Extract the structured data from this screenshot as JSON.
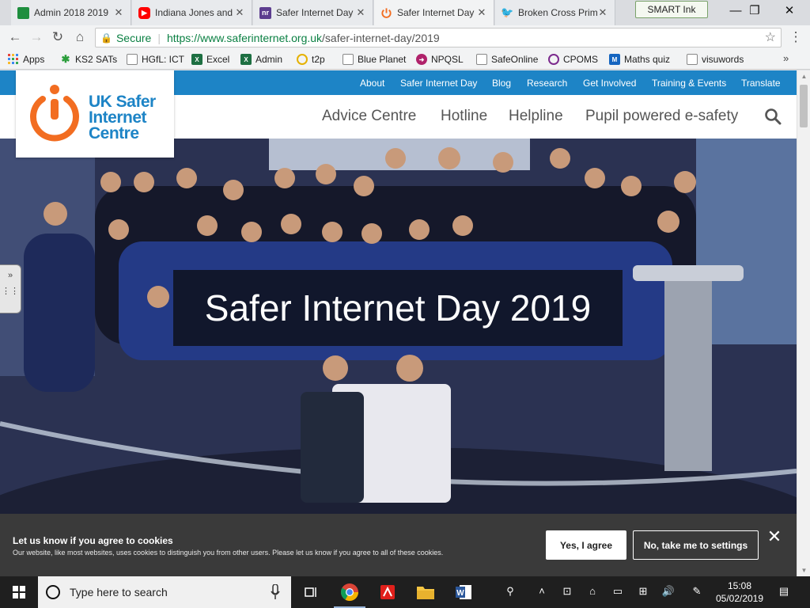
{
  "browser": {
    "tabs": [
      {
        "title": "Admin 2018 2019",
        "favicon": "google-sheets-icon",
        "color": "#1e8e3e"
      },
      {
        "title": "Indiana Jones and",
        "favicon": "youtube-icon",
        "color": "#ff0000"
      },
      {
        "title": "Safer Internet Day",
        "favicon": "nr-icon",
        "color": "#5c3d8f"
      },
      {
        "title": "Safer Internet Day",
        "favicon": "power-icon",
        "color": "#f26d21"
      },
      {
        "title": "Broken Cross Prim",
        "favicon": "twitter-icon",
        "color": "#1da1f2"
      }
    ],
    "tab_close": "✕",
    "smart_ink": "SMART Ink",
    "window_controls": {
      "minimize": "—",
      "restore": "❐",
      "close": "✕"
    },
    "nav": {
      "back": "←",
      "forward": "→",
      "reload": "↻",
      "home": "⌂"
    },
    "omnibox": {
      "secure_label": "Secure",
      "url_host": "https://www.saferinternet.org.uk",
      "url_path": "/safer-internet-day/2019",
      "bookmark_star": "☆"
    },
    "menu": "⋮",
    "bookmarks": [
      {
        "label": "Apps",
        "icon": "apps-grid-icon",
        "color": "#e8453c"
      },
      {
        "label": "KS2 SATs",
        "icon": "ks2-icon",
        "color": "#2a9d3a"
      },
      {
        "label": "HGfL: ICT",
        "icon": "page-icon",
        "color": "#888888"
      },
      {
        "label": "Excel",
        "icon": "excel-icon",
        "color": "#1d6f42"
      },
      {
        "label": "Admin",
        "icon": "excel-icon",
        "color": "#1d6f42"
      },
      {
        "label": "t2p",
        "icon": "smiley-icon",
        "color": "#e5b100"
      },
      {
        "label": "Blue Planet",
        "icon": "page-icon",
        "color": "#888888"
      },
      {
        "label": "NPQSL",
        "icon": "arrow-circle-icon",
        "color": "#b0226b"
      },
      {
        "label": "SafeOnline",
        "icon": "page-icon",
        "color": "#888888"
      },
      {
        "label": "CPOMS",
        "icon": "target-icon",
        "color": "#7b2a8d"
      },
      {
        "label": "Maths quiz",
        "icon": "m-icon",
        "color": "#1565c0"
      },
      {
        "label": "visuwords",
        "icon": "page-icon",
        "color": "#888888"
      }
    ],
    "bookmarks_more": "»"
  },
  "site": {
    "logo_text": [
      "UK Safer",
      "Internet",
      "Centre"
    ],
    "brand_orange": "#f26d21",
    "brand_blue": "#1d84c6",
    "top_links": [
      "About",
      "Safer Internet Day",
      "Blog",
      "Research",
      "Get Involved",
      "Training & Events",
      "Translate"
    ],
    "main_nav": [
      "Advice Centre",
      "Hotline",
      "Helpline",
      "Pupil powered e-safety"
    ],
    "hero_title": "Safer Internet Day 2019",
    "side_tab_icons": [
      "»",
      "⋮⋮"
    ],
    "cookie": {
      "title": "Let us know if you agree to cookies",
      "text": "Our website, like most websites, uses cookies to distinguish you from other users. Please let us know if you agree to all of these cookies.",
      "accept_label": "Yes, I agree",
      "settings_label": "No, take me to settings",
      "close": "✕"
    }
  },
  "taskbar": {
    "search_placeholder": "Type here to search",
    "tray": [
      "⚲",
      "˄",
      "⊡",
      "⌂",
      "▭",
      "⊞",
      "🔊",
      "✎"
    ],
    "clock": {
      "time": "15:08",
      "date": "05/02/2019"
    },
    "notification": "▤"
  }
}
